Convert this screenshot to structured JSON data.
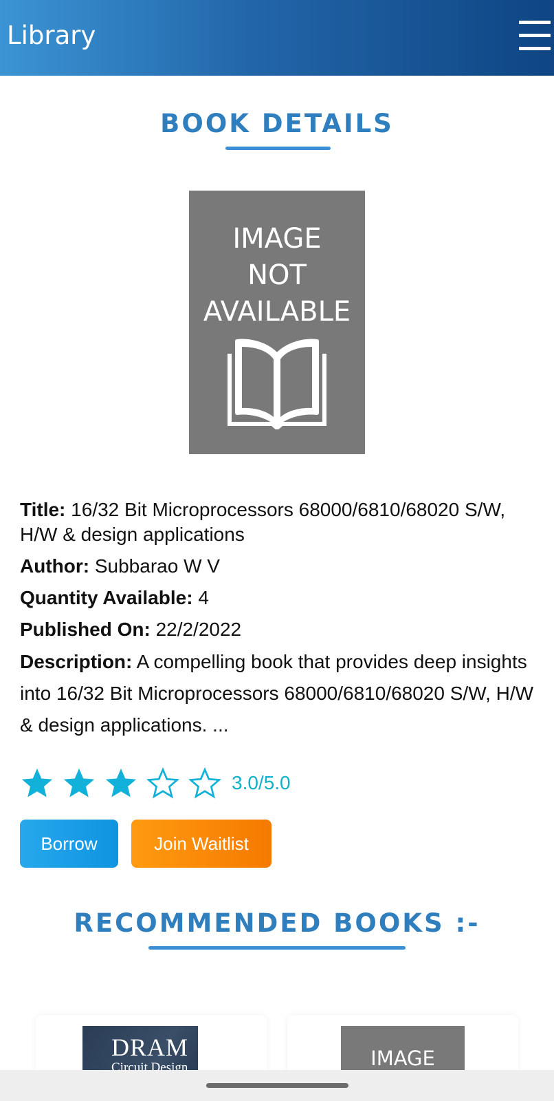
{
  "header": {
    "title": "Library",
    "menu_icon": "hamburger-menu-icon"
  },
  "book_details": {
    "heading": "BOOK DETAILS",
    "cover": {
      "line1": "IMAGE",
      "line2": "NOT",
      "line3": "AVAILABLE",
      "icon": "open-book-icon"
    },
    "title_label": "Title:",
    "title_value": "16/32 Bit Microprocessors 68000/6810/68020 S/W, H/W & design applications",
    "author_label": "Author:",
    "author_value": "Subbarao W V",
    "quantity_label": "Quantity Available:",
    "quantity_value": "4",
    "published_label": "Published On:",
    "published_value": "22/2/2022",
    "description_label": "Description:",
    "description_value": "A compelling book that provides deep insights into 16/32 Bit Microprocessors 68000/6810/68020 S/W, H/W & design applications. ...",
    "rating": {
      "value": 3.0,
      "max": 5,
      "text": "3.0/5.0",
      "color": "#12b1c9"
    }
  },
  "actions": {
    "borrow_label": "Borrow",
    "waitlist_label": "Join Waitlist"
  },
  "recommended": {
    "heading": "RECOMMENDED BOOKS :-",
    "items": [
      {
        "thumb_title": "DRAM",
        "thumb_subtitle": "Circuit Design"
      },
      {
        "thumb_text": "IMAGE"
      }
    ]
  },
  "colors": {
    "accent": "#2f7fbe",
    "borrow": "#1a9fe6",
    "waitlist": "#f78a00",
    "header_start": "#3b94d4",
    "header_end": "#0f4583"
  }
}
